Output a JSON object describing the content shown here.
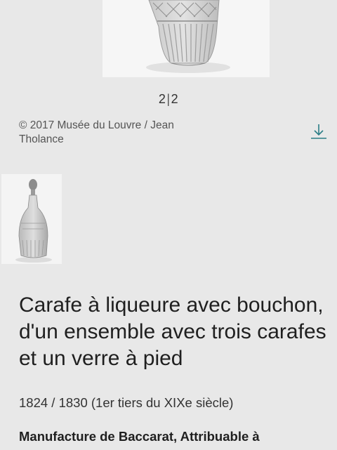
{
  "gallery": {
    "current": "2",
    "separator": "|",
    "total": "2",
    "credit": "© 2017 Musée du Louvre / Jean Tholance",
    "download_icon": "download-icon"
  },
  "artwork": {
    "title_lines": [
      "Carafe à liqueure avec bouchon,",
      "d'un ensemble avec trois carafes",
      "et un verre à pied"
    ],
    "date": "1824 / 1830 (1er tiers du XIXe siècle)",
    "maker": "Manufacture de Baccarat, Attribuable à"
  },
  "colors": {
    "background": "#e8e8e8",
    "image_background": "#f6f6f6",
    "download_accent": "#2a7d86"
  }
}
